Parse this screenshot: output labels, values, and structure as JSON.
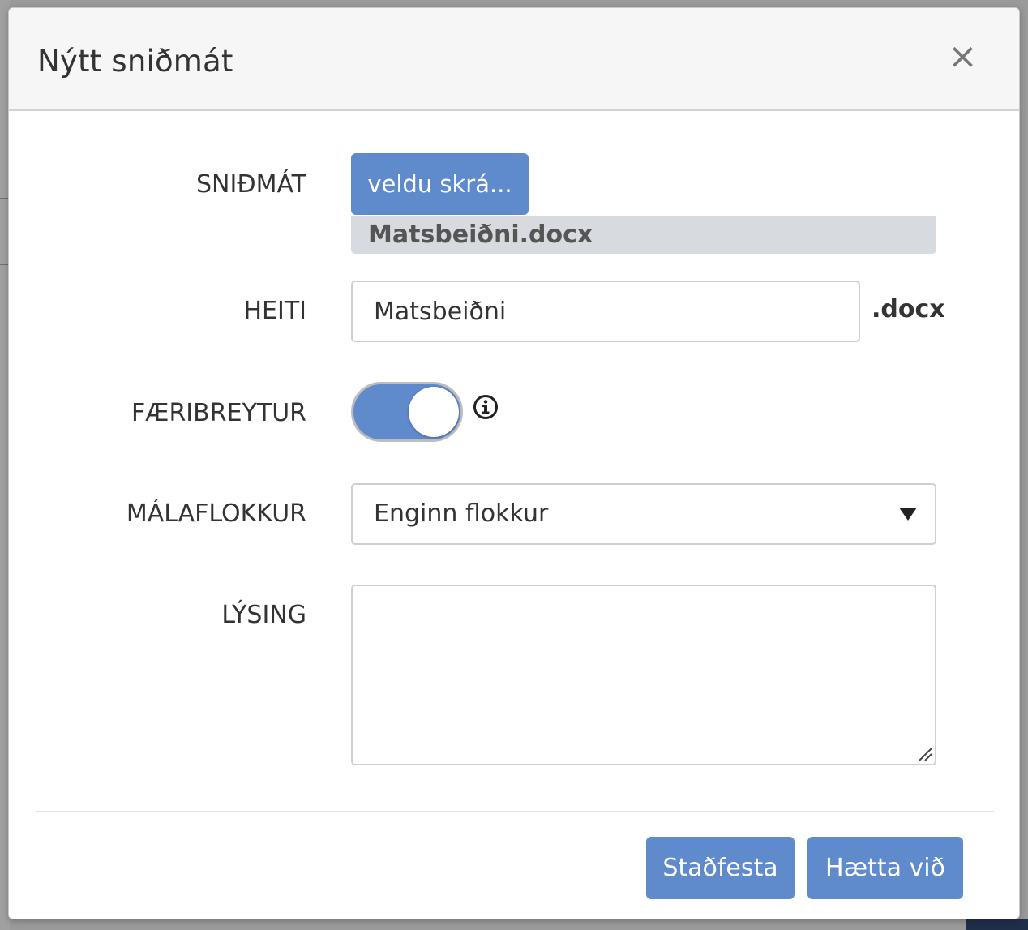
{
  "modal": {
    "title": "Nýtt sniðmát",
    "close_label": "×"
  },
  "form": {
    "template": {
      "label": "SNIÐMÁT",
      "button_label": "veldu skrá...",
      "file_name": "Matsbeiðni.docx"
    },
    "name": {
      "label": "HEITI",
      "value": "Matsbeiðni",
      "suffix": ".docx"
    },
    "parameters": {
      "label": "FÆRIBREYTUR",
      "enabled": true,
      "icon": "info-icon"
    },
    "category": {
      "label": "MÁLAFLOKKUR",
      "selected": "Enginn flokkur",
      "icon": "caret-down-icon"
    },
    "description": {
      "label": "LÝSING",
      "value": ""
    }
  },
  "footer": {
    "confirm_label": "Staðfesta",
    "cancel_label": "Hætta við"
  },
  "colors": {
    "accent": "#5f8bcc",
    "file_name_bg": "#d7dbdf",
    "header_bg": "#f6f6f6"
  }
}
